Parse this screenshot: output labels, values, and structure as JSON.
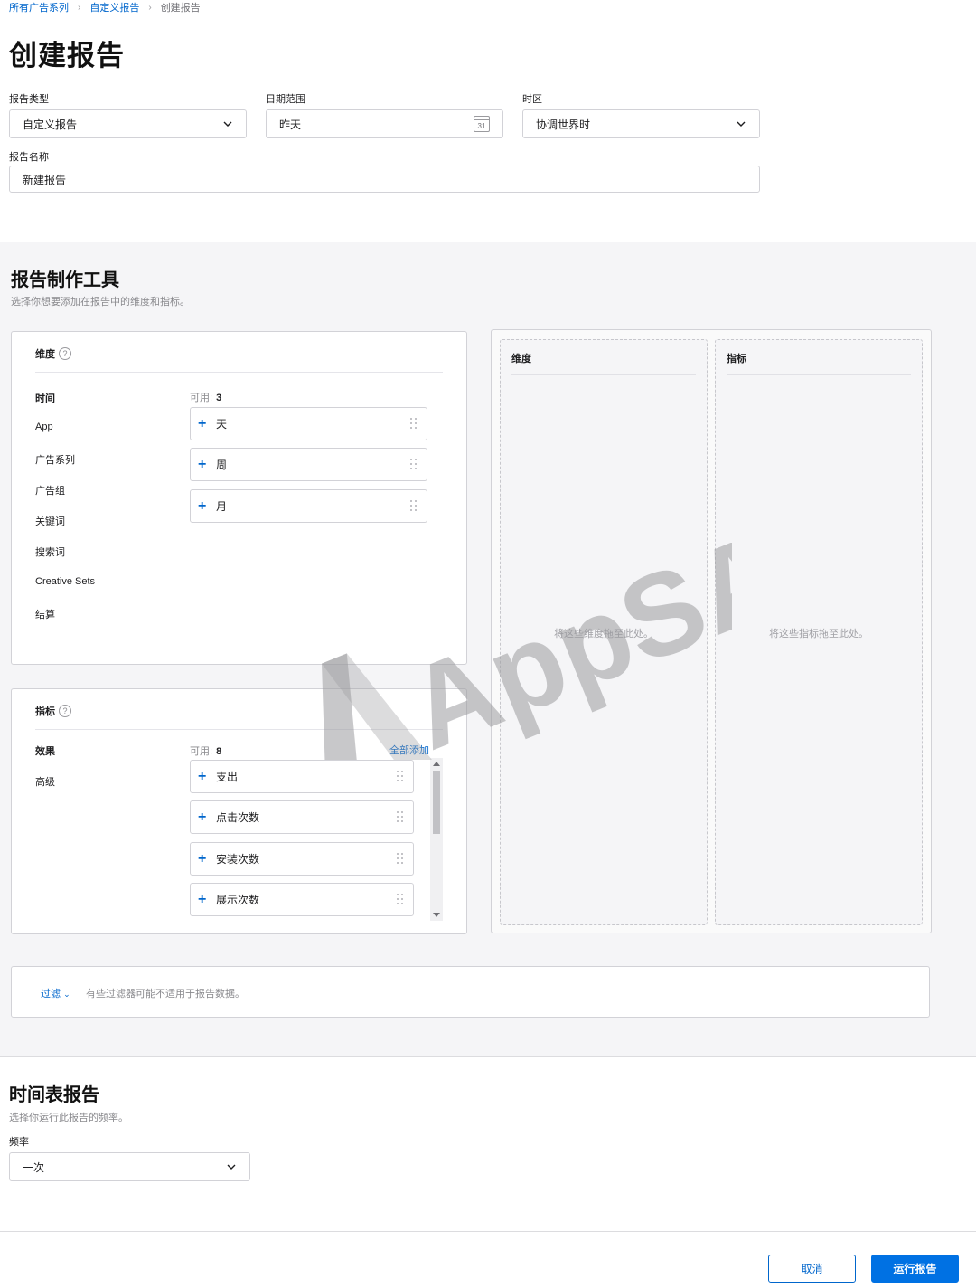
{
  "breadcrumb": {
    "items": [
      "所有广告系列",
      "自定义报告",
      "创建报告"
    ]
  },
  "page": {
    "title": "创建报告"
  },
  "form": {
    "report_type": {
      "label": "报告类型",
      "value": "自定义报告"
    },
    "date_range": {
      "label": "日期范围",
      "value": "昨天",
      "calendar_day": "31"
    },
    "timezone": {
      "label": "时区",
      "value": "协调世界时"
    },
    "report_name": {
      "label": "报告名称",
      "value": "新建报告"
    }
  },
  "builder": {
    "title": "报告制作工具",
    "subtitle": "选择你想要添加在报告中的维度和指标。",
    "dimensions": {
      "title": "维度",
      "help": "?",
      "categories": [
        "时间",
        "App",
        "广告系列",
        "广告组",
        "关键词",
        "搜索词",
        "Creative Sets",
        "结算"
      ],
      "available_label": "可用:",
      "available_count": "3",
      "items": [
        "天",
        "周",
        "月"
      ]
    },
    "metrics": {
      "title": "指标",
      "help": "?",
      "categories": [
        "效果",
        "高级"
      ],
      "available_label": "可用:",
      "available_count": "8",
      "add_all": "全部添加",
      "items": [
        "支出",
        "点击次数",
        "安装次数",
        "展示次数"
      ]
    },
    "drop_dimensions": {
      "title": "维度",
      "hint": "将这些维度拖至此处。"
    },
    "drop_metrics": {
      "title": "指标",
      "hint": "将这些指标拖至此处。"
    }
  },
  "filter": {
    "link": "过滤",
    "note": "有些过滤器可能不适用于报告数据。"
  },
  "schedule": {
    "title": "时间表报告",
    "subtitle": "选择你运行此报告的频率。",
    "frequency_label": "频率",
    "frequency_value": "一次"
  },
  "actions": {
    "cancel": "取消",
    "run": "运行报告"
  },
  "watermark": {
    "text": "AppSA"
  },
  "colors": {
    "accent": "#0066cc",
    "primary_button": "#0071e3",
    "section_bg": "#f5f5f7"
  }
}
